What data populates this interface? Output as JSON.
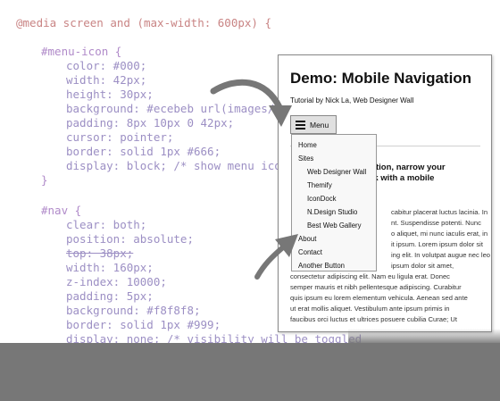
{
  "code": {
    "media_line": "@media screen and (max-width: 600px) {",
    "menu_icon_selector": "#menu-icon {",
    "menu_icon_props": [
      "color: #000;",
      "width: 42px;",
      "height: 30px;",
      "background: #ecebeb url(images/me",
      "padding: 8px 10px 0 42px;",
      "cursor: pointer;",
      "border: solid 1px #666;",
      "display: block; /* show menu icon"
    ],
    "close_brace": "}",
    "nav_selector": "#nav {",
    "nav_props": [
      "clear: both;",
      "position: absolute;",
      "top: 38px;",
      "width: 160px;",
      "z-index: 10000;",
      "padding: 5px;",
      "background: #f8f8f8;",
      "border: solid 1px #999;",
      "display: none; /* visibility will be toggled"
    ]
  },
  "demo": {
    "title": "Demo: Mobile Navigation",
    "subtitle": "Tutorial by Nick La, Web Designer Wall",
    "menu_label": "Menu",
    "nav_items": [
      "Home",
      "Sites",
      "Web Designer Wall",
      "Themify",
      "IconDock",
      "N.Design Studio",
      "Best Web Gallery",
      "About",
      "Contact",
      "Another Button"
    ],
    "article_heading": "vigation, narrow your\nheck with a mobile",
    "article_lines": [
      "cabitur placerat luctus lacinia. In",
      "nt. Suspendisse potenti. Nunc",
      "o aliquet, mi nunc iaculis erat, in",
      "it ipsum. Lorem ipsum dolor sit",
      "ing elit. In volutpat augue nec leo",
      "ipsum dolor sit amet,",
      "consectetur adipiscing elit. Nam eu ligula erat. Donec",
      "semper mauris et nibh pellentesque adipiscing. Curabitur",
      "quis ipsum eu lorem elementum vehicula. Aenean sed ante",
      "ut erat mollis aliquet. Vestibulum ante ipsum primis in",
      "faucibus orci luctus et ultrices posuere cubilia Curae; Ut"
    ]
  },
  "colors": {
    "media": "#c98484",
    "selector": "#b08ac9",
    "property": "#9c8fc4",
    "bottom_bar": "#777777"
  }
}
